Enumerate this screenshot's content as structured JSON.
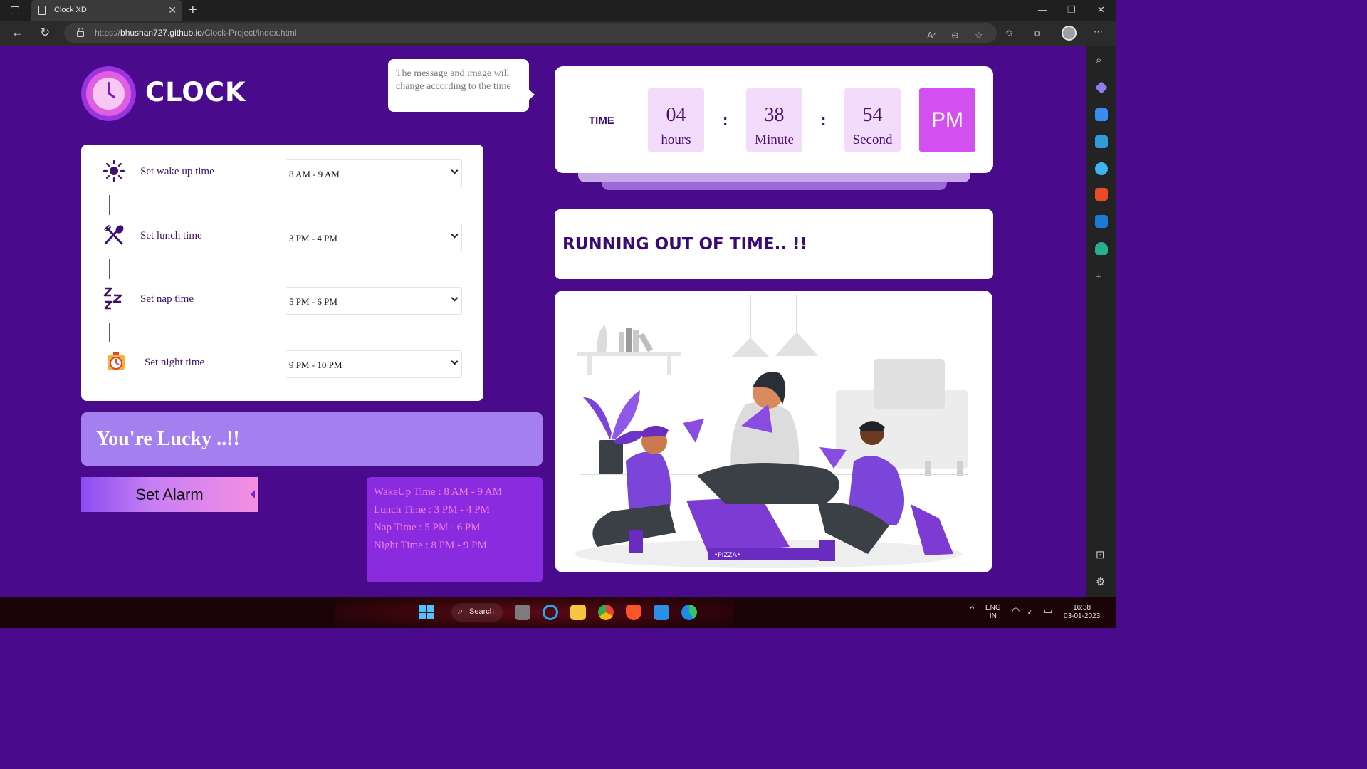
{
  "browser": {
    "tab_title": "Clock XD",
    "tab_close": "✕",
    "new_tab": "+",
    "url_prefix": "https://",
    "url_host": "bhushan727.github.io",
    "url_path": "/Clock-Project/index.html",
    "window_controls": [
      "—",
      "❐",
      "✕"
    ]
  },
  "page": {
    "logo_text": "CLOCK",
    "bubble_text": "The message and image will change according to the time",
    "rows": [
      {
        "label": "Set wake up time",
        "value": "8 AM - 9 AM",
        "icon": "sun-icon"
      },
      {
        "label": "Set lunch time",
        "value": "3 PM - 4 PM",
        "icon": "fork-knife-icon"
      },
      {
        "label": "Set nap time",
        "value": "5 PM - 6 PM",
        "icon": "zzz-icon"
      },
      {
        "label": "Set night time",
        "value": "9 PM - 10 PM",
        "icon": "alarm-clock-icon"
      }
    ],
    "lucky_text": "You're Lucky ..!!",
    "alarm_button": "Set Alarm",
    "summary": [
      "WakeUp Time : 8 AM - 9 AM",
      "Lunch Time : 3 PM - 4 PM",
      "Nap Time : 5 PM - 6 PM",
      "Night Time : 8 PM - 9 PM"
    ],
    "time": {
      "label": "TIME",
      "hours": "04",
      "hours_unit": "hours",
      "minutes": "38",
      "minutes_unit": "Minute",
      "seconds": "54",
      "seconds_unit": "Second",
      "ampm": "PM",
      "separator": ":"
    },
    "message": "RUNNING OUT OF TIME.. !!"
  },
  "taskbar": {
    "search_label": "Search",
    "lang_top": "ENG",
    "lang_bottom": "IN",
    "clock_time": "16:38",
    "clock_date": "03-01-2023"
  },
  "colors": {
    "page_bg": "#4a0a8c",
    "accent": "#d24ff0",
    "dark_text": "#3a0a74"
  }
}
